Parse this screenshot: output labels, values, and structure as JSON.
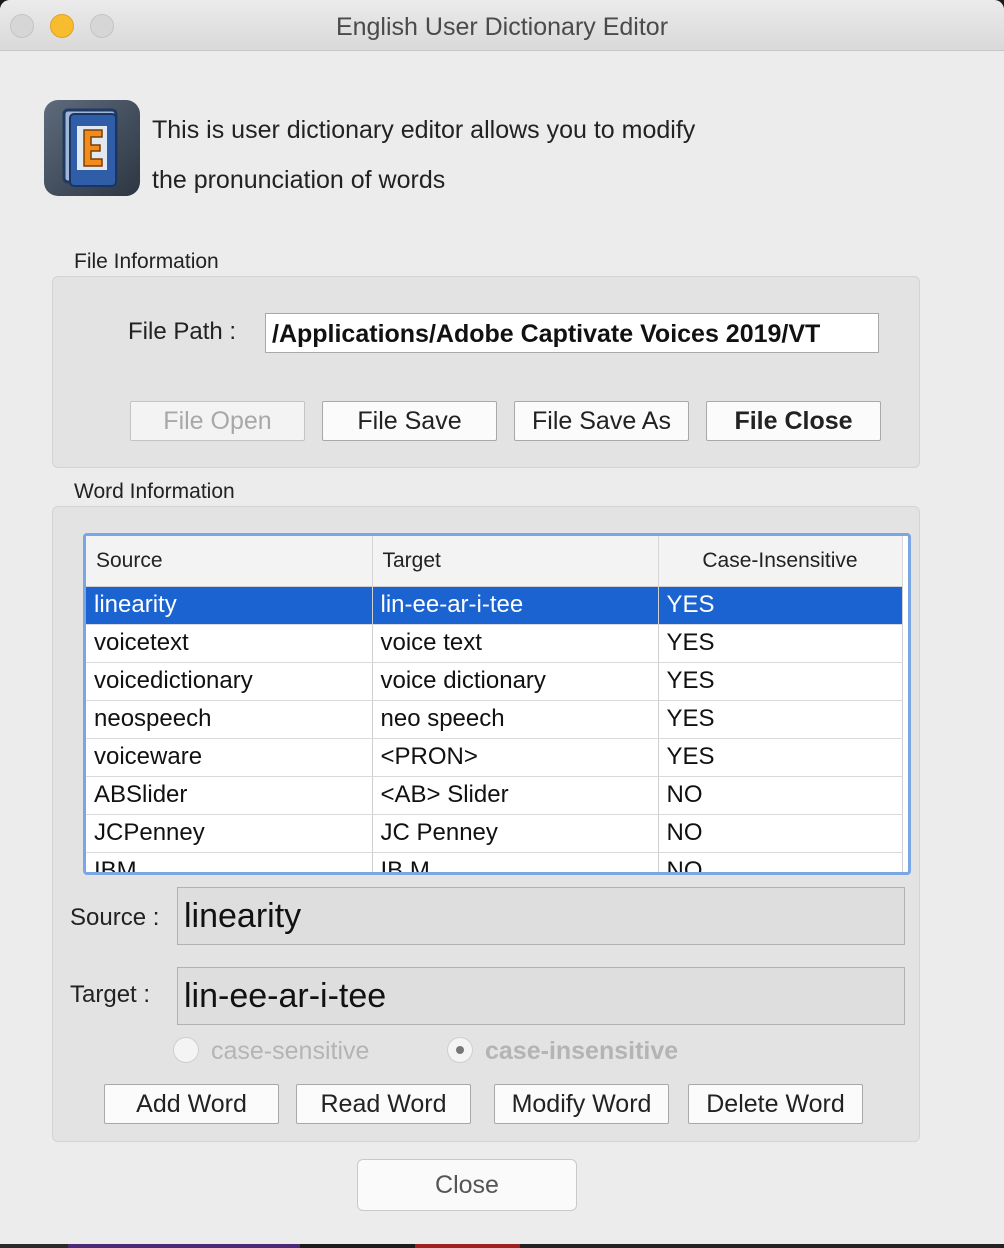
{
  "window": {
    "title": "English User Dictionary Editor"
  },
  "intro": {
    "line1": "This is user dictionary editor allows you to modify",
    "line2": "the pronunciation of words",
    "icon": "dictionary-book-icon"
  },
  "file_info": {
    "group_label": "File Information",
    "path_label": "File Path :",
    "path_value": "/Applications/Adobe Captivate Voices 2019/VT",
    "buttons": {
      "open": "File Open",
      "save": "File Save",
      "save_as": "File Save As",
      "close": "File Close"
    }
  },
  "word_info": {
    "group_label": "Word Information",
    "columns": [
      "Source",
      "Target",
      "Case-Insensitive"
    ],
    "rows": [
      {
        "source": "linearity",
        "target": "lin-ee-ar-i-tee",
        "case": "YES"
      },
      {
        "source": "voicetext",
        "target": "voice text",
        "case": "YES"
      },
      {
        "source": "voicedictionary",
        "target": "voice dictionary",
        "case": "YES"
      },
      {
        "source": "neospeech",
        "target": "neo speech",
        "case": "YES"
      },
      {
        "source": "voiceware",
        "target": "<PRON>",
        "case": "YES"
      },
      {
        "source": "ABSlider",
        "target": "<AB> Slider",
        "case": "NO"
      },
      {
        "source": "JCPenney",
        "target": "JC Penney",
        "case": "NO"
      },
      {
        "source": "IBM",
        "target": "IB M",
        "case": "NO"
      }
    ],
    "source_label": "Source :",
    "source_value": "linearity",
    "target_label": "Target :",
    "target_value": "lin-ee-ar-i-tee",
    "radio_sensitive": "case-sensitive",
    "radio_insensitive": "case-insensitive",
    "buttons": {
      "add": "Add Word",
      "read": "Read Word",
      "modify": "Modify Word",
      "delete": "Delete Word"
    }
  },
  "footer": {
    "close": "Close"
  },
  "colors": {
    "selection": "#1a63d0",
    "table_focus": "#7aa6e6",
    "minimize": "#f7bd2e"
  }
}
